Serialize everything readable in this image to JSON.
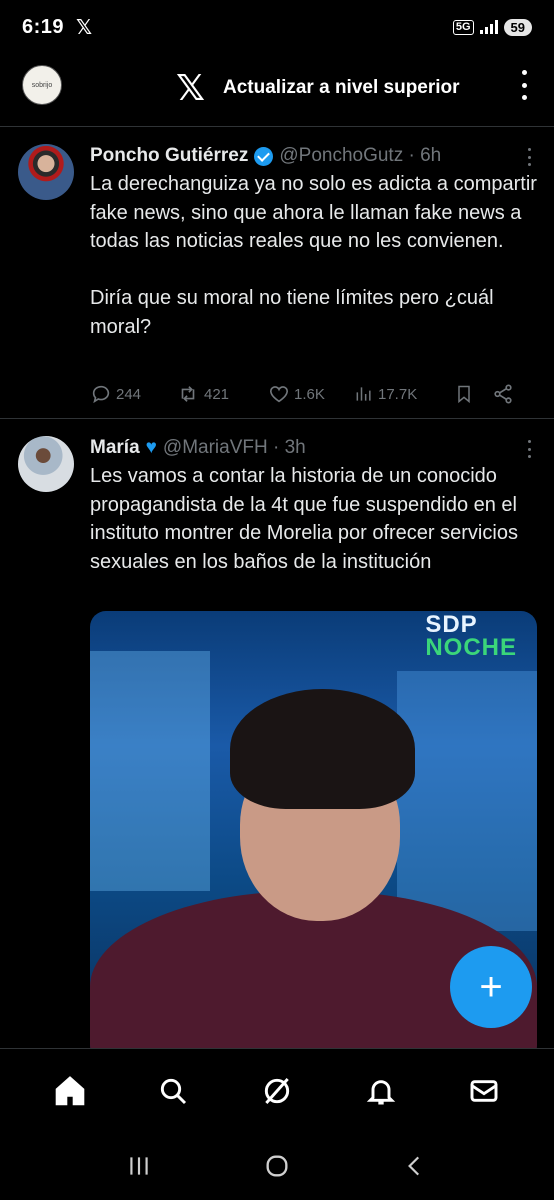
{
  "status_bar": {
    "time": "6:19",
    "network": "5G",
    "battery": "59"
  },
  "top_bar": {
    "avatar_text": "sobrijo",
    "upgrade_label": "Actualizar a nivel superior"
  },
  "tweets": [
    {
      "name": "Poncho Gutiérrez",
      "handle": "@PonchoGutz · 6h",
      "text": "La derechanguiza ya no solo es adicta a compartir fake news, sino que ahora le llaman fake news a todas las noticias reales que no les convienen.\n\nDiría que su moral no tiene límites pero ¿cuál moral?",
      "replies": "244",
      "reposts": "421",
      "likes": "1.6K",
      "views": "17.7K"
    },
    {
      "name": "María",
      "handle": "@MariaVFH · 3h",
      "text": "Les vamos a contar la historia de un conocido propagandista de la 4t que fue suspendido en el instituto montrer de Morelia por ofrecer servicios sexuales en los baños de la institución",
      "media_brand_line1": "SDP",
      "media_brand_line2": "NOCHE"
    }
  ],
  "fab": {
    "label": "+"
  },
  "tabs": [
    "home",
    "search",
    "grok",
    "notifications",
    "messages"
  ]
}
